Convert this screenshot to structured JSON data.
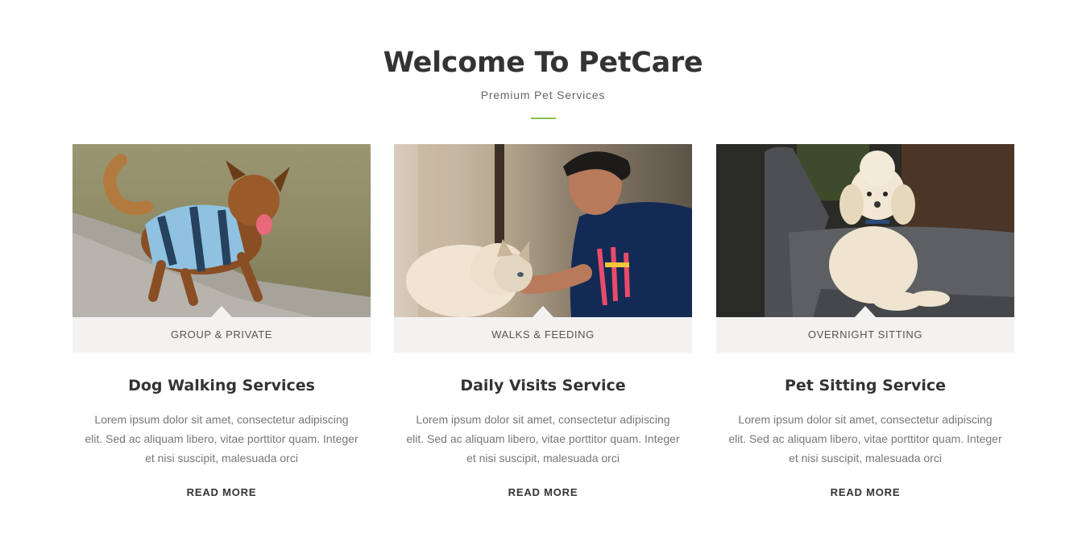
{
  "section": {
    "title": "Welcome To PetCare",
    "subtitle": "Premium Pet Services",
    "accent_color": "#8cc152"
  },
  "cards": [
    {
      "image_icon": "dog-running-photo",
      "tag": "GROUP & PRIVATE",
      "title": "Dog Walking Services",
      "text": "Lorem ipsum dolor sit amet, consectetur adipiscing elit. Sed ac aliquam libero, vitae porttitor quam. Integer et nisi suscipit, malesuada orci",
      "link": "READ MORE"
    },
    {
      "image_icon": "man-with-cat-photo",
      "tag": "WALKS & FEEDING",
      "title": "Daily Visits Service",
      "text": "Lorem ipsum dolor sit amet, consectetur adipiscing elit. Sed ac aliquam libero, vitae porttitor quam. Integer et nisi suscipit, malesuada orci",
      "link": "READ MORE"
    },
    {
      "image_icon": "poodle-on-chair-photo",
      "tag": "OVERNIGHT SITTING",
      "title": "Pet Sitting Service",
      "text": "Lorem ipsum dolor sit amet, consectetur adipiscing elit. Sed ac aliquam libero, vitae porttitor quam. Integer et nisi suscipit, malesuada orci",
      "link": "READ MORE"
    }
  ]
}
